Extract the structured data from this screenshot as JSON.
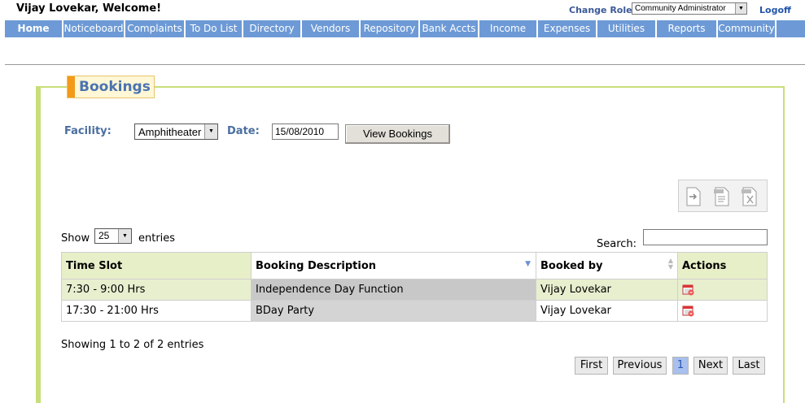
{
  "header": {
    "welcome": "Vijay Lovekar, Welcome!",
    "change_role_label": "Change Role:",
    "role_value": "Community Administrator",
    "logoff": "Logoff"
  },
  "nav": {
    "tabs": [
      "Home",
      "Noticeboard",
      "Complaints",
      "To Do List",
      "Directory",
      "Vendors",
      "Repository",
      "Bank Accts",
      "Income",
      "Expenses",
      "Utilities",
      "Reports",
      "Community"
    ],
    "active": "Home"
  },
  "section": {
    "title": "Bookings"
  },
  "filters": {
    "facility_label": "Facility:",
    "facility_value": "Amphitheater",
    "date_label": "Date:",
    "date_value": "15/08/2010",
    "view_button": "View Bookings"
  },
  "toolbar": {
    "icons": [
      "export-icon",
      "csv-icon",
      "xls-icon"
    ]
  },
  "table_controls": {
    "show_label": "Show",
    "entries_value": "25",
    "entries_label": "entries",
    "search_label": "Search:",
    "search_value": ""
  },
  "table": {
    "columns": [
      "Time Slot",
      "Booking Description",
      "Booked by",
      "Actions"
    ],
    "rows": [
      {
        "time_slot": "7:30 - 9:00 Hrs",
        "description": "Independence Day Function",
        "booked_by": "Vijay Lovekar",
        "action_icon": "calendar-delete-icon"
      },
      {
        "time_slot": "17:30 - 21:00 Hrs",
        "description": "BDay Party",
        "booked_by": "Vijay Lovekar",
        "action_icon": "calendar-delete-icon"
      }
    ]
  },
  "pagination": {
    "info": "Showing 1 to 2 of 2 entries",
    "first": "First",
    "previous": "Previous",
    "current": "1",
    "next": "Next",
    "last": "Last"
  }
}
